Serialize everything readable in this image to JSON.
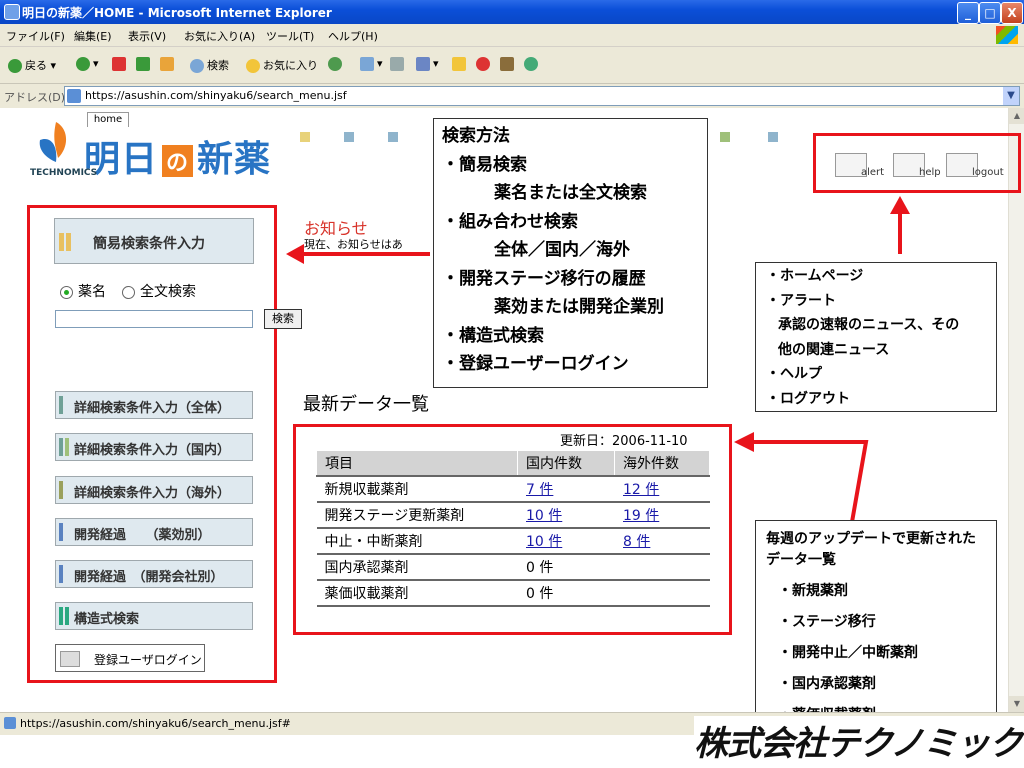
{
  "window": {
    "title": "明日の新薬／HOME - Microsoft Internet Explorer",
    "min": "_",
    "max": "□",
    "close": "X"
  },
  "menu": [
    "ファイル(F)",
    "編集(E)",
    "表示(V)",
    "お気に入り(A)",
    "ツール(T)",
    "ヘルプ(H)"
  ],
  "toolbar": {
    "back": "戻る",
    "search": "検索",
    "favorites": "お気に入り"
  },
  "address": {
    "label": "アドレス(D)",
    "url": "https://asushin.com/shinyaku6/search_menu.jsf"
  },
  "status": {
    "text": "https://asushin.com/shinyaku6/search_menu.jsf#"
  },
  "site": {
    "home_tab": "home",
    "logo_a": "明日",
    "logo_no": "の",
    "logo_b": "新薬",
    "logo_sub": "TECHNOMICS"
  },
  "nav": {
    "alert": "alert",
    "help": "help",
    "logout": "logout"
  },
  "left": {
    "easy": "簡易検索条件入力",
    "radio_name": "薬名",
    "radio_full": "全文検索",
    "search_btn": "検索",
    "search_value": "",
    "buttons": [
      {
        "label": "詳細検索条件入力（全体）",
        "color": "#6fa096"
      },
      {
        "label": "詳細検索条件入力（国内）",
        "color": "#6fa096"
      },
      {
        "label": "詳細検索条件入力（海外）",
        "color": "#9aa05c"
      },
      {
        "label": "開発経過　　（薬効別）",
        "color": "#5a82c0"
      },
      {
        "label": "開発経過　（開発会社別）",
        "color": "#5a82c0"
      },
      {
        "label": "構造式検索",
        "color": "#2aa880"
      }
    ],
    "login": "登録ユーザログイン"
  },
  "news": {
    "title": "お知らせ",
    "text": "現在、お知らせはあ"
  },
  "latest": {
    "title": "最新データ一覧",
    "updated": "更新日：2006-11-10",
    "headers": [
      "項目",
      "国内件数",
      "海外件数"
    ],
    "rows": [
      [
        "新規収載薬剤",
        "7 件",
        "12 件"
      ],
      [
        "開発ステージ更新薬剤",
        "10 件",
        "19 件"
      ],
      [
        "中止・中断薬剤",
        "10 件",
        "8 件"
      ],
      [
        "国内承認薬剤",
        "0 件",
        ""
      ],
      [
        "薬価収載薬剤",
        "0 件",
        ""
      ]
    ]
  },
  "callouts": {
    "search": {
      "title": "検索方法",
      "lines": [
        "・簡易検索",
        "薬名または全文検索",
        "・組み合わせ検索",
        "全体／国内／海外",
        "・開発ステージ移行の履歴",
        "薬効または開発企業別",
        "・構造式検索",
        "・登録ユーザーログイン"
      ]
    },
    "nav": {
      "lines": [
        "・ホームページ",
        "・アラート",
        "承認の速報のニュース、その",
        "他の関連ニュース",
        "・ヘルプ",
        "・ログアウト"
      ]
    },
    "update": {
      "title": "毎週のアップデートで更新されたデータ一覧",
      "items": [
        "・新規薬剤",
        "・ステージ移行",
        "・開発中止／中断薬剤",
        "・国内承認薬剤",
        "・薬価収載薬剤"
      ]
    }
  },
  "brand": "株式会社テクノミック",
  "colors": {
    "accent_red": "#e8141b",
    "logo_blue": "#2874c4",
    "logo_orange": "#f08020",
    "link": "#1a1aa8"
  }
}
